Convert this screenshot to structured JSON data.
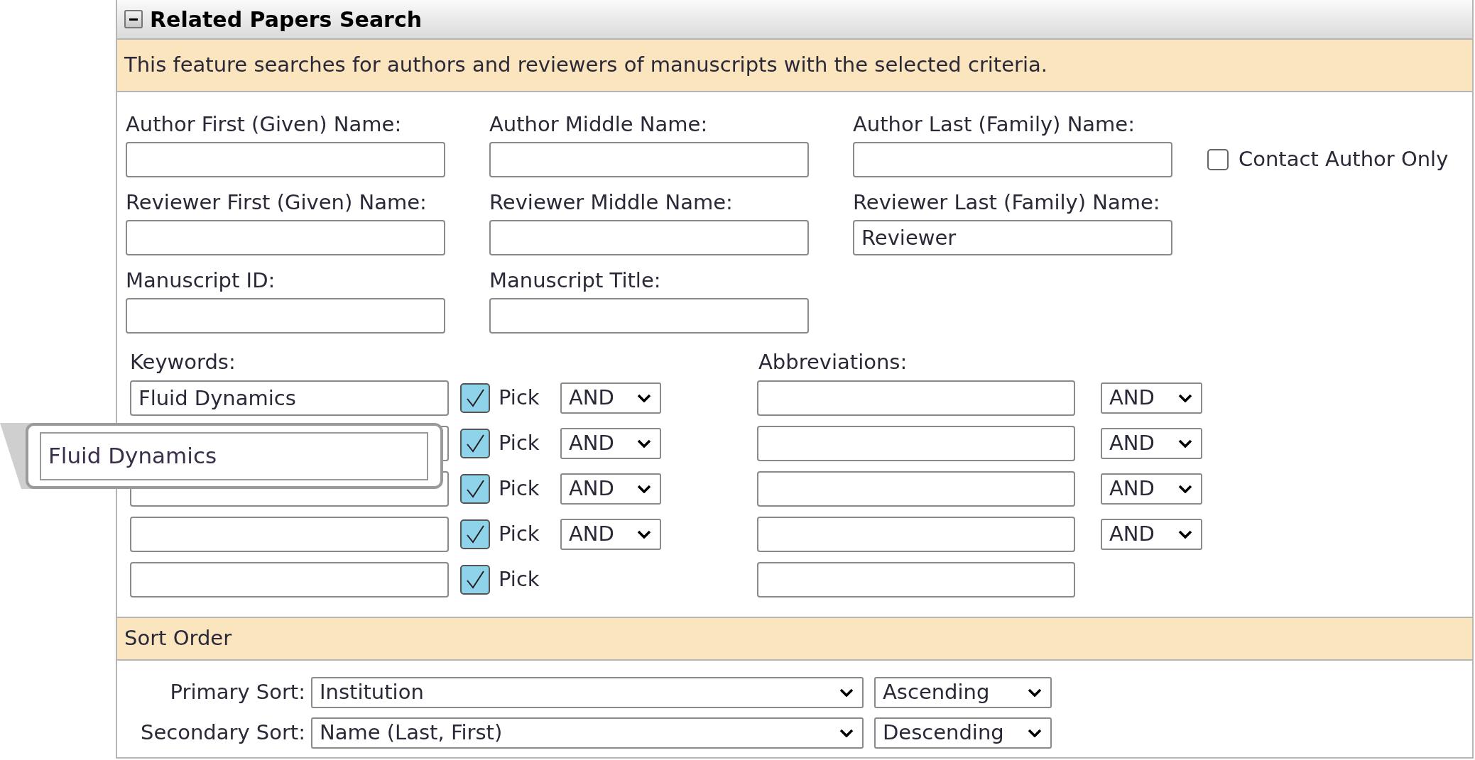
{
  "panel": {
    "title": "Related Papers Search",
    "expanded": true
  },
  "info": "This feature searches for authors and reviewers of manuscripts with the selected criteria.",
  "name_rows": [
    [
      {
        "label": "Author First (Given) Name:"
      },
      {
        "label": "Author Middle Name:"
      },
      {
        "label": "Author Last (Family) Name:"
      }
    ],
    [
      {
        "label": "Reviewer First (Given) Name:"
      },
      {
        "label": "Reviewer Middle Name:"
      },
      {
        "label": "Reviewer Last (Family) Name:",
        "value": "Reviewer"
      }
    ],
    [
      {
        "label": "Manuscript ID:"
      },
      {
        "label": "Manuscript Title:"
      }
    ]
  ],
  "contact_author_only": {
    "label": "Contact Author Only",
    "checked": false
  },
  "keywords": {
    "label": "Keywords:",
    "rows": [
      {
        "value": "Fluid Dynamics",
        "pick_label": "Pick",
        "pick_checked": true,
        "operator": "AND"
      },
      {
        "pick_label": "Pick",
        "pick_checked": true,
        "operator": "AND"
      },
      {
        "pick_label": "Pick",
        "pick_checked": true,
        "operator": "AND"
      },
      {
        "pick_label": "Pick",
        "pick_checked": true,
        "operator": "AND"
      },
      {
        "pick_label": "Pick",
        "pick_checked": true
      }
    ]
  },
  "abbreviations": {
    "label": "Abbreviations:",
    "rows": [
      {
        "operator": "AND"
      },
      {
        "operator": "AND"
      },
      {
        "operator": "AND"
      },
      {
        "operator": "AND"
      },
      {}
    ]
  },
  "magnifier": {
    "text": "Fluid Dynamics"
  },
  "sort": {
    "title": "Sort Order",
    "rows": [
      {
        "label": "Primary Sort:",
        "field": "Institution",
        "direction": "Ascending"
      },
      {
        "label": "Secondary Sort:",
        "field": "Name (Last, First)",
        "direction": "Descending"
      }
    ]
  }
}
